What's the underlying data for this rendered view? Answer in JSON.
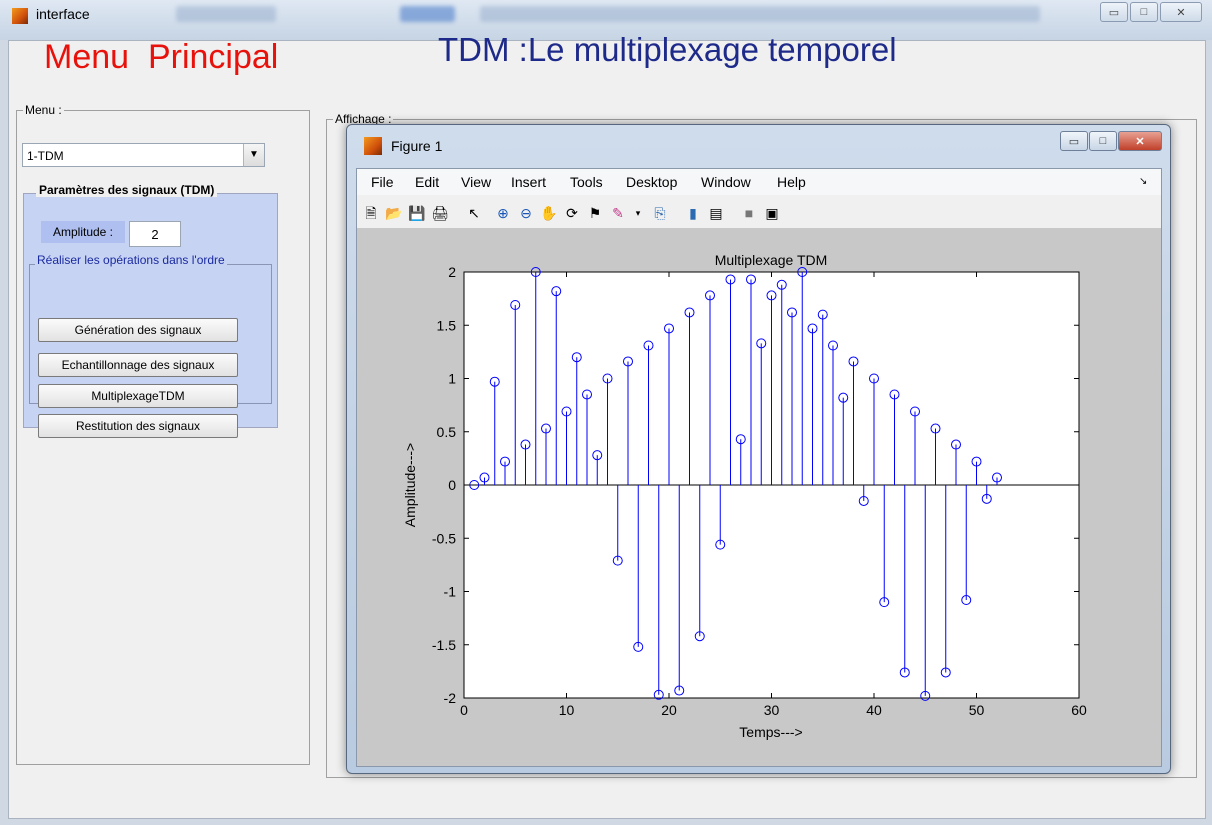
{
  "window": {
    "title": "interface"
  },
  "left": {
    "menu_title": "Menu  Principal",
    "menu_legend": "Menu :",
    "select_value": "1-TDM",
    "params_legend": "Paramètres des signaux (TDM)",
    "amplitude_label": "Amplitude :",
    "amplitude_value": "2",
    "ops_legend": "Réaliser les opérations dans l'ordre",
    "buttons": [
      "Génération des signaux",
      "Echantillonnage des signaux",
      "MultiplexageTDM",
      "Restitution des signaux"
    ]
  },
  "main": {
    "title": "TDM :Le multiplexage temporel",
    "affichage_legend": "Affichage :"
  },
  "figure": {
    "title": "Figure 1",
    "menu": [
      "File",
      "Edit",
      "View",
      "Insert",
      "Tools",
      "Desktop",
      "Window",
      "Help"
    ]
  },
  "chart_data": {
    "type": "stem",
    "title": "Multiplexage TDM",
    "xlabel": "Temps--->",
    "ylabel": "Amplitude--->",
    "xlim": [
      0,
      60
    ],
    "ylim": [
      -2,
      2
    ],
    "xticks": [
      0,
      10,
      20,
      30,
      40,
      50,
      60
    ],
    "yticks": [
      2,
      1.5,
      1,
      0.5,
      0,
      -0.5,
      -1,
      -1.5,
      -2
    ],
    "grid": false,
    "color": "#0000ff",
    "x": [
      1,
      2,
      3,
      4,
      5,
      6,
      7,
      8,
      9,
      10,
      11,
      12,
      13,
      14,
      15,
      16,
      17,
      18,
      19,
      20,
      21,
      22,
      23,
      24,
      25,
      26,
      27,
      28,
      29,
      30,
      31,
      32,
      33,
      34,
      35,
      36,
      37,
      38,
      39,
      40,
      41,
      42,
      43,
      44,
      45,
      46,
      47,
      48,
      49,
      50,
      51,
      52
    ],
    "y": [
      0,
      0.07,
      0.97,
      0.22,
      1.69,
      0.38,
      2.0,
      0.53,
      1.82,
      0.69,
      1.2,
      0.85,
      0.28,
      1.0,
      -0.71,
      1.16,
      -1.52,
      1.31,
      -1.97,
      1.47,
      -1.93,
      1.62,
      -1.42,
      1.78,
      -0.56,
      1.93,
      0.43,
      1.93,
      1.33,
      1.78,
      1.88,
      1.62,
      2.0,
      1.47,
      1.6,
      1.31,
      0.82,
      1.16,
      -0.15,
      1.0,
      -1.1,
      0.85,
      -1.76,
      0.69,
      -1.98,
      0.53,
      -1.76,
      0.38,
      -1.08,
      0.22,
      -0.13,
      0.07
    ]
  }
}
